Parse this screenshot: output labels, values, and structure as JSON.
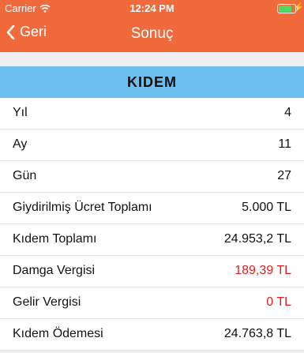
{
  "status": {
    "carrier": "Carrier",
    "time": "12:24 PM"
  },
  "nav": {
    "back_label": "Geri",
    "title": "Sonuç"
  },
  "section_title": "KIDEM",
  "rows": [
    {
      "label": "Yıl",
      "value": "4"
    },
    {
      "label": "Ay",
      "value": "11"
    },
    {
      "label": "Gün",
      "value": "27"
    },
    {
      "label": "Giydirilmiş Ücret Toplamı",
      "value": "5.000 TL"
    },
    {
      "label": "Kıdem Toplamı",
      "value": "24.953,2 TL"
    },
    {
      "label": "Damga Vergisi",
      "value": "189,39 TL"
    },
    {
      "label": "Gelir Vergisi",
      "value": "0 TL"
    },
    {
      "label": "Kıdem Ödemesi",
      "value": "24.763,8 TL"
    }
  ],
  "colors": {
    "header": "#f06a3c",
    "section": "#6dbff0",
    "negative": "#e02020"
  }
}
